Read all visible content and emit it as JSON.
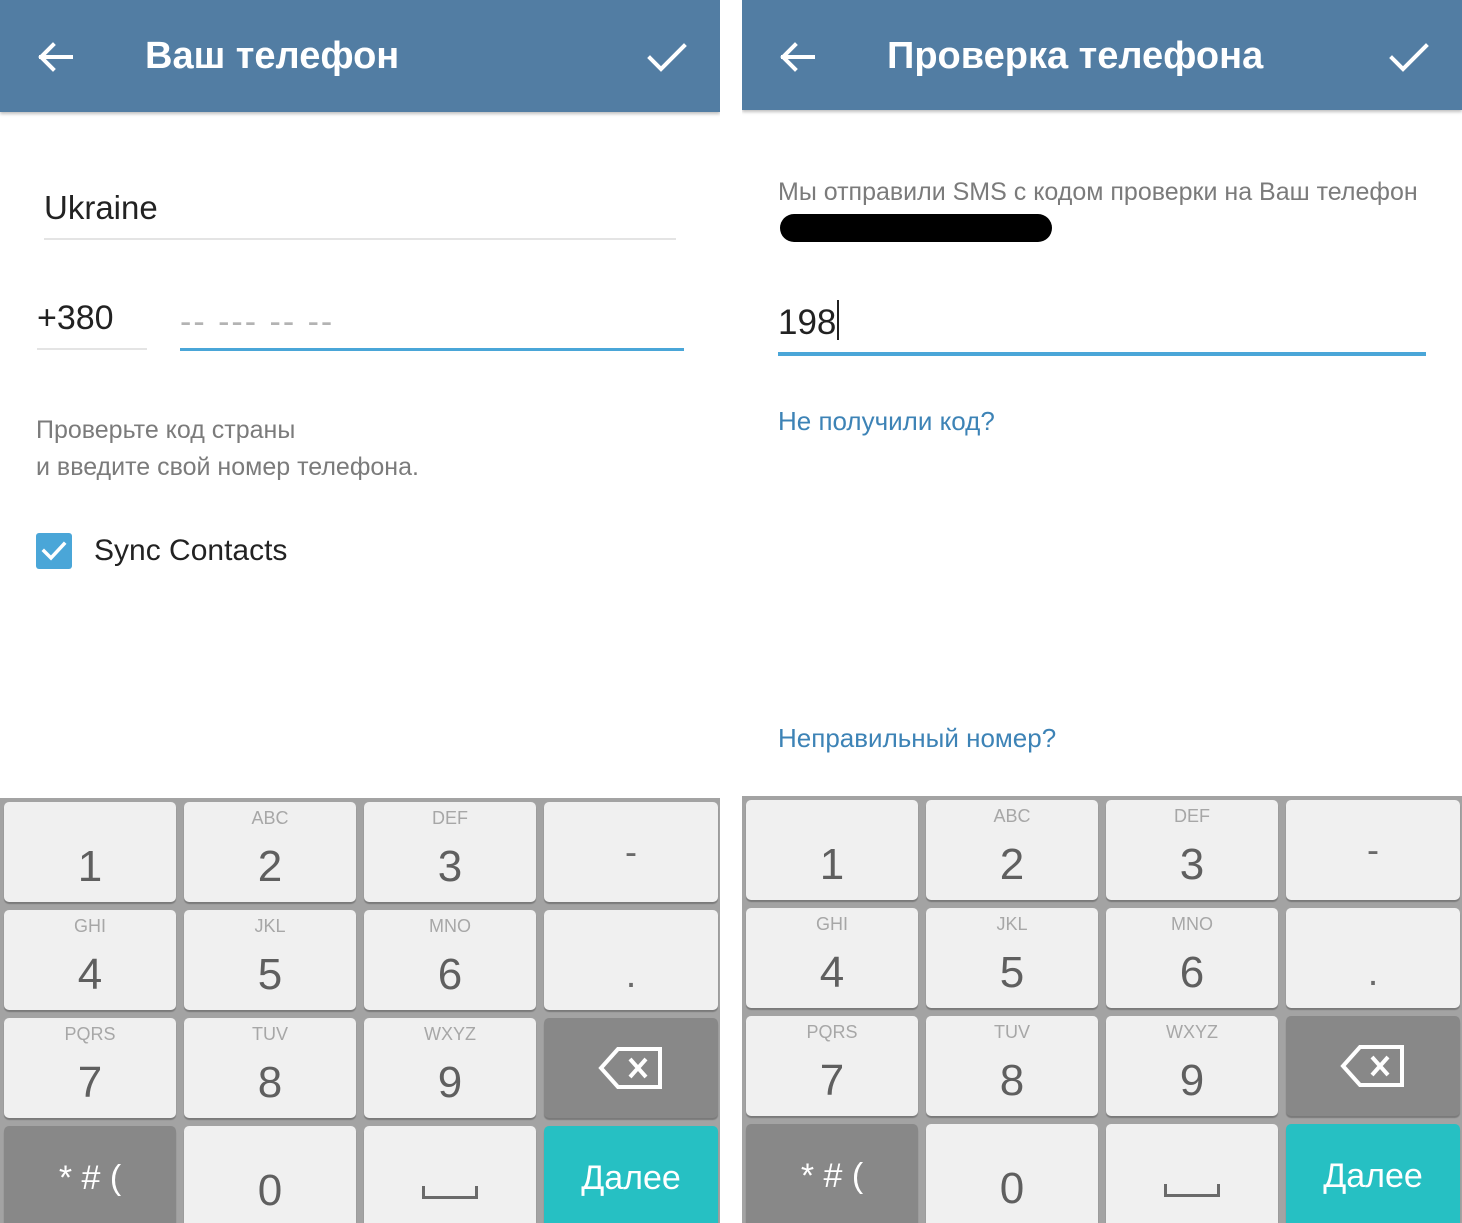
{
  "colors": {
    "header": "#527da3",
    "accent": "#4aa6d8",
    "link": "#3d83b6",
    "next_key": "#26c0c3",
    "function_key": "#888888"
  },
  "keypad": {
    "keys": [
      {
        "digit": "1",
        "letters": ""
      },
      {
        "digit": "2",
        "letters": "ABC"
      },
      {
        "digit": "3",
        "letters": "DEF"
      },
      {
        "symbol": "-"
      },
      {
        "digit": "4",
        "letters": "GHI"
      },
      {
        "digit": "5",
        "letters": "JKL"
      },
      {
        "digit": "6",
        "letters": "MNO"
      },
      {
        "symbol": "."
      },
      {
        "digit": "7",
        "letters": "PQRS"
      },
      {
        "digit": "8",
        "letters": "TUV"
      },
      {
        "digit": "9",
        "letters": "WXYZ"
      },
      {
        "icon": "backspace-icon"
      },
      {
        "symbol": "* # ("
      },
      {
        "digit": "0",
        "letters": ""
      },
      {
        "icon": "space-bar-icon"
      },
      {
        "label": "Далее"
      }
    ]
  },
  "left_screen": {
    "header": {
      "title": "Ваш телефон",
      "back_icon": "arrow-left-icon",
      "confirm_icon": "checkmark-icon"
    },
    "country": "Ukraine",
    "country_code": "+380",
    "phone": {
      "value": "",
      "placeholder": "-- --- -- --"
    },
    "hint": [
      "Проверьте код страны",
      "и введите свой номер телефона."
    ],
    "sync_contacts": {
      "label": "Sync Contacts",
      "checked": true
    }
  },
  "right_screen": {
    "header": {
      "title": "Проверка телефона",
      "back_icon": "arrow-left-icon",
      "confirm_icon": "checkmark-icon"
    },
    "message": "Мы отправили SMS с кодом проверки на Ваш телефон",
    "code_value": "198",
    "no_code_link": "Не получили код?",
    "wrong_number_link": "Неправильный номер?"
  }
}
